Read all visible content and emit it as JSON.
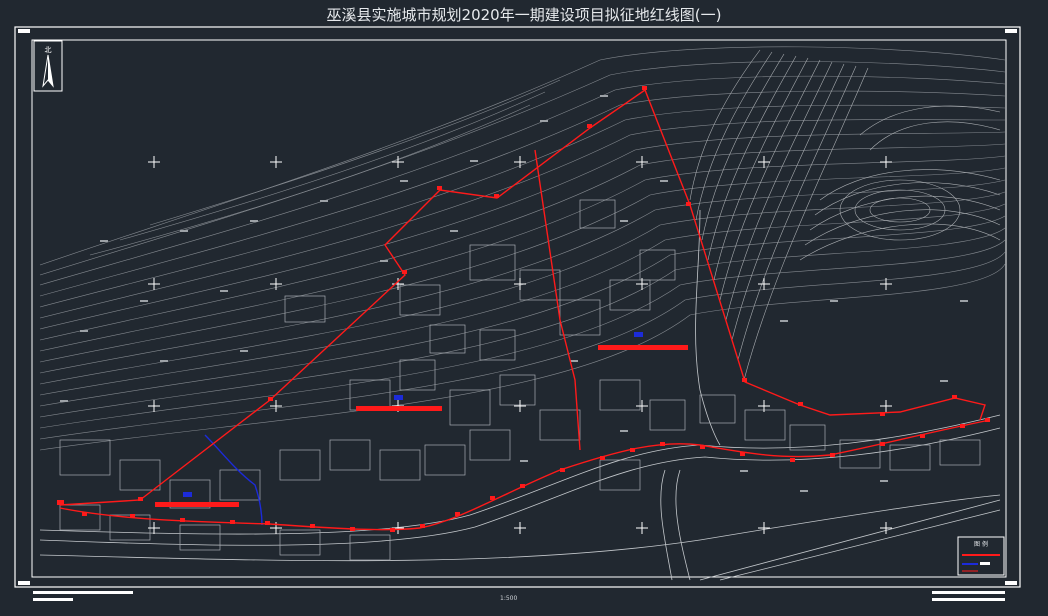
{
  "title": "巫溪县实施城市规划2020年一期建设项目拟征地红线图(一)",
  "north_label": "北",
  "legend": {
    "title": "图 例"
  },
  "scale_text": "1:500",
  "colors": {
    "background": "#212830",
    "frame": "#ffffff",
    "contour": "#8f949a",
    "building": "#a8adb2",
    "red_line": "#ff1a1a",
    "blue_line": "#1c2bd9"
  },
  "icons": {
    "north_arrow": "north-arrow-icon",
    "grid_cross": "cross-marker-icon"
  }
}
